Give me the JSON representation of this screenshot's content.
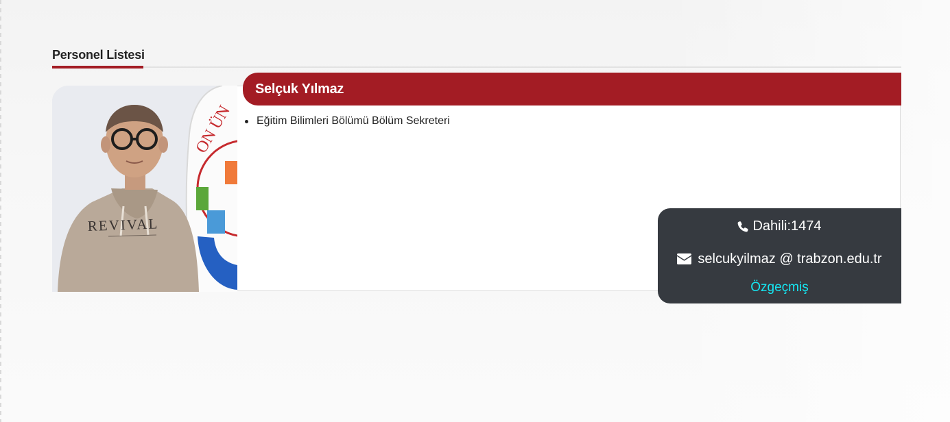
{
  "section": {
    "title": "Personel Listesi"
  },
  "person": {
    "name": "Selçuk Yılmaz",
    "roles": [
      "Eğitim Bilimleri Bölümü Bölüm Sekreteri"
    ],
    "photo_shirt_text": "REVIVAL",
    "flag_text": "ON ÜN"
  },
  "contact": {
    "phone_icon": "phone-icon",
    "phone": "Dahili:1474",
    "email_icon": "envelope-icon",
    "email": "selcukyilmaz @ trabzon.edu.tr",
    "cv_label": "Özgeçmiş"
  },
  "colors": {
    "accent": "#a31c24",
    "contact_panel": "#363a40",
    "link": "#15e6f2"
  }
}
